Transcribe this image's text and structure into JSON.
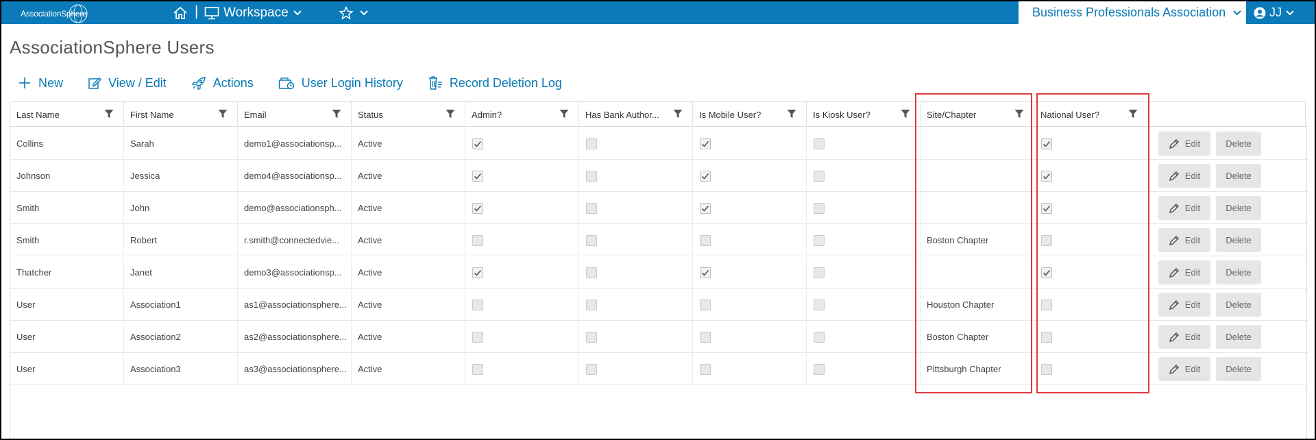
{
  "topbar": {
    "logo_text": "AssociationSphere",
    "separator": "|",
    "workspace_label": "Workspace",
    "org_name": "Business Professionals Association",
    "user_initials": "JJ"
  },
  "page": {
    "title": "AssociationSphere Users"
  },
  "toolbar": {
    "new_label": "New",
    "view_edit_label": "View / Edit",
    "actions_label": "Actions",
    "login_history_label": "User Login History",
    "deletion_log_label": "Record Deletion Log"
  },
  "table": {
    "columns": [
      "Last Name",
      "First Name",
      "Email",
      "Status",
      "Admin?",
      "Has Bank Author...",
      "Is Mobile User?",
      "Is Kiosk User?",
      "Site/Chapter",
      "National User?"
    ],
    "edit_label": "Edit",
    "delete_label": "Delete",
    "rows": [
      {
        "last": "Collins",
        "first": "Sarah",
        "email": "demo1@associationsp...",
        "status": "Active",
        "admin": true,
        "bank": false,
        "mobile": true,
        "kiosk": false,
        "chapter": "",
        "national": true
      },
      {
        "last": "Johnson",
        "first": "Jessica",
        "email": "demo4@associationsp...",
        "status": "Active",
        "admin": true,
        "bank": false,
        "mobile": true,
        "kiosk": false,
        "chapter": "",
        "national": true
      },
      {
        "last": "Smith",
        "first": "John",
        "email": "demo@associationsph...",
        "status": "Active",
        "admin": true,
        "bank": false,
        "mobile": true,
        "kiosk": false,
        "chapter": "",
        "national": true
      },
      {
        "last": "Smith",
        "first": "Robert",
        "email": "r.smith@connectedvie...",
        "status": "Active",
        "admin": false,
        "bank": false,
        "mobile": false,
        "kiosk": false,
        "chapter": "Boston Chapter",
        "national": false
      },
      {
        "last": "Thatcher",
        "first": "Janet",
        "email": "demo3@associationsp...",
        "status": "Active",
        "admin": true,
        "bank": false,
        "mobile": true,
        "kiosk": false,
        "chapter": "",
        "national": true
      },
      {
        "last": "User",
        "first": "Association1",
        "email": "as1@associationsphere...",
        "status": "Active",
        "admin": false,
        "bank": false,
        "mobile": false,
        "kiosk": false,
        "chapter": "Houston Chapter",
        "national": false
      },
      {
        "last": "User",
        "first": "Association2",
        "email": "as2@associationsphere...",
        "status": "Active",
        "admin": false,
        "bank": false,
        "mobile": false,
        "kiosk": false,
        "chapter": "Boston Chapter",
        "national": false
      },
      {
        "last": "User",
        "first": "Association3",
        "email": "as3@associationsphere...",
        "status": "Active",
        "admin": false,
        "bank": false,
        "mobile": false,
        "kiosk": false,
        "chapter": "Pittsburgh Chapter",
        "national": false
      }
    ]
  },
  "colors": {
    "brand": "#0a7ab8",
    "highlight": "#e0393e"
  }
}
